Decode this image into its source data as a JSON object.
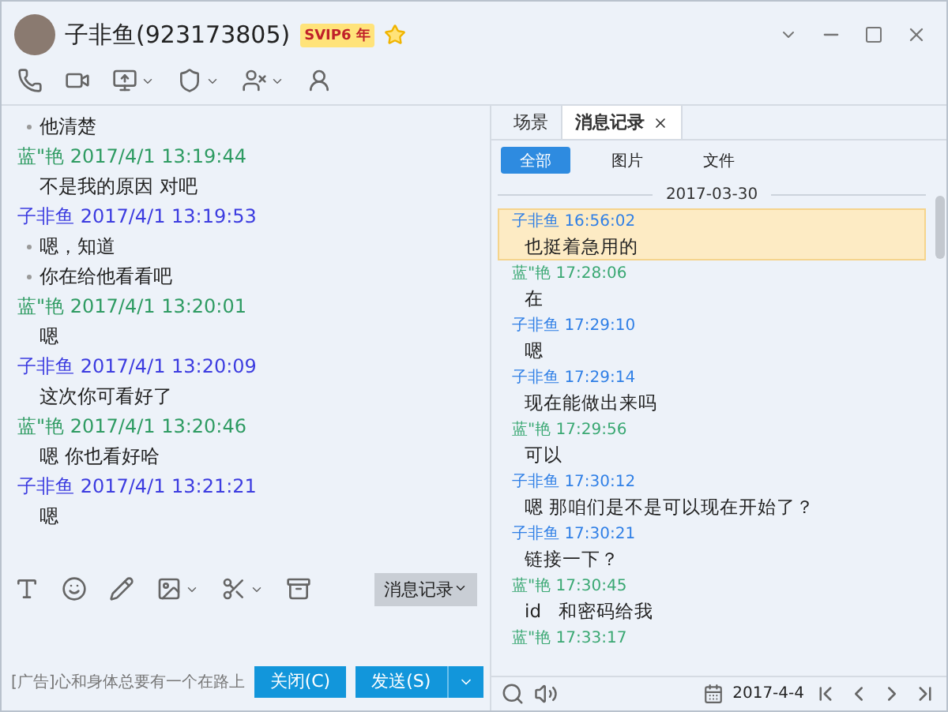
{
  "window": {
    "title": "子非鱼(923173805)",
    "badge": "SVIP6",
    "badge_suffix": "年"
  },
  "chat": [
    {
      "kind": "bullet",
      "text": "他清楚"
    },
    {
      "kind": "header",
      "sender": "蓝\"艳",
      "time": "2017/4/1 13:19:44",
      "color": "#2e9b62"
    },
    {
      "kind": "text",
      "text": "不是我的原因 对吧"
    },
    {
      "kind": "header",
      "sender": "子非鱼",
      "time": "2017/4/1 13:19:53",
      "color": "#3c3ce0"
    },
    {
      "kind": "bullet",
      "text": "嗯，知道"
    },
    {
      "kind": "bullet",
      "text": "你在给他看看吧"
    },
    {
      "kind": "header",
      "sender": "蓝\"艳",
      "time": "2017/4/1 13:20:01",
      "color": "#2e9b62"
    },
    {
      "kind": "text",
      "text": "嗯"
    },
    {
      "kind": "header",
      "sender": "子非鱼",
      "time": "2017/4/1 13:20:09",
      "color": "#3c3ce0"
    },
    {
      "kind": "text",
      "text": "这次你可看好了"
    },
    {
      "kind": "header",
      "sender": "蓝\"艳",
      "time": "2017/4/1 13:20:46",
      "color": "#2e9b62"
    },
    {
      "kind": "text",
      "text": "嗯 你也看好哈"
    },
    {
      "kind": "header",
      "sender": "子非鱼",
      "time": "2017/4/1 13:21:21",
      "color": "#3c3ce0"
    },
    {
      "kind": "text",
      "text": "嗯"
    }
  ],
  "history_button": "消息记录",
  "ad": "[广告]心和身体总要有一个在路上",
  "buttons": {
    "close": "关闭(C)",
    "send": "发送(S)"
  },
  "tabs": [
    {
      "label": "场景",
      "selected": false,
      "closable": false
    },
    {
      "label": "消息记录",
      "selected": true,
      "closable": true
    }
  ],
  "filters": [
    {
      "label": "全部",
      "selected": true
    },
    {
      "label": "图片",
      "selected": false
    },
    {
      "label": "文件",
      "selected": false
    }
  ],
  "date_divider": "2017-03-30",
  "history": [
    {
      "sender": "子非鱼",
      "time": "16:56:02",
      "text": "也挺着急用的",
      "color": "#2f7fe6",
      "selected": true
    },
    {
      "sender": "蓝\"艳",
      "time": "17:28:06",
      "text": "在",
      "color": "#3aa873",
      "selected": false
    },
    {
      "sender": "子非鱼",
      "time": "17:29:10",
      "text": "嗯",
      "color": "#2f7fe6",
      "selected": false
    },
    {
      "sender": "子非鱼",
      "time": "17:29:14",
      "text": "现在能做出来吗",
      "color": "#2f7fe6",
      "selected": false
    },
    {
      "sender": "蓝\"艳",
      "time": "17:29:56",
      "text": "可以",
      "color": "#3aa873",
      "selected": false
    },
    {
      "sender": "子非鱼",
      "time": "17:30:12",
      "text": "嗯 那咱们是不是可以现在开始了？",
      "color": "#2f7fe6",
      "selected": false
    },
    {
      "sender": "子非鱼",
      "time": "17:30:21",
      "text": "链接一下？",
      "color": "#2f7fe6",
      "selected": false
    },
    {
      "sender": "蓝\"艳",
      "time": "17:30:45",
      "text": "id   和密码给我",
      "color": "#3aa873",
      "selected": false
    },
    {
      "sender": "蓝\"艳",
      "time": "17:33:17",
      "color": "#3aa873",
      "selected": false
    }
  ],
  "date_picker": "2017-4-4"
}
